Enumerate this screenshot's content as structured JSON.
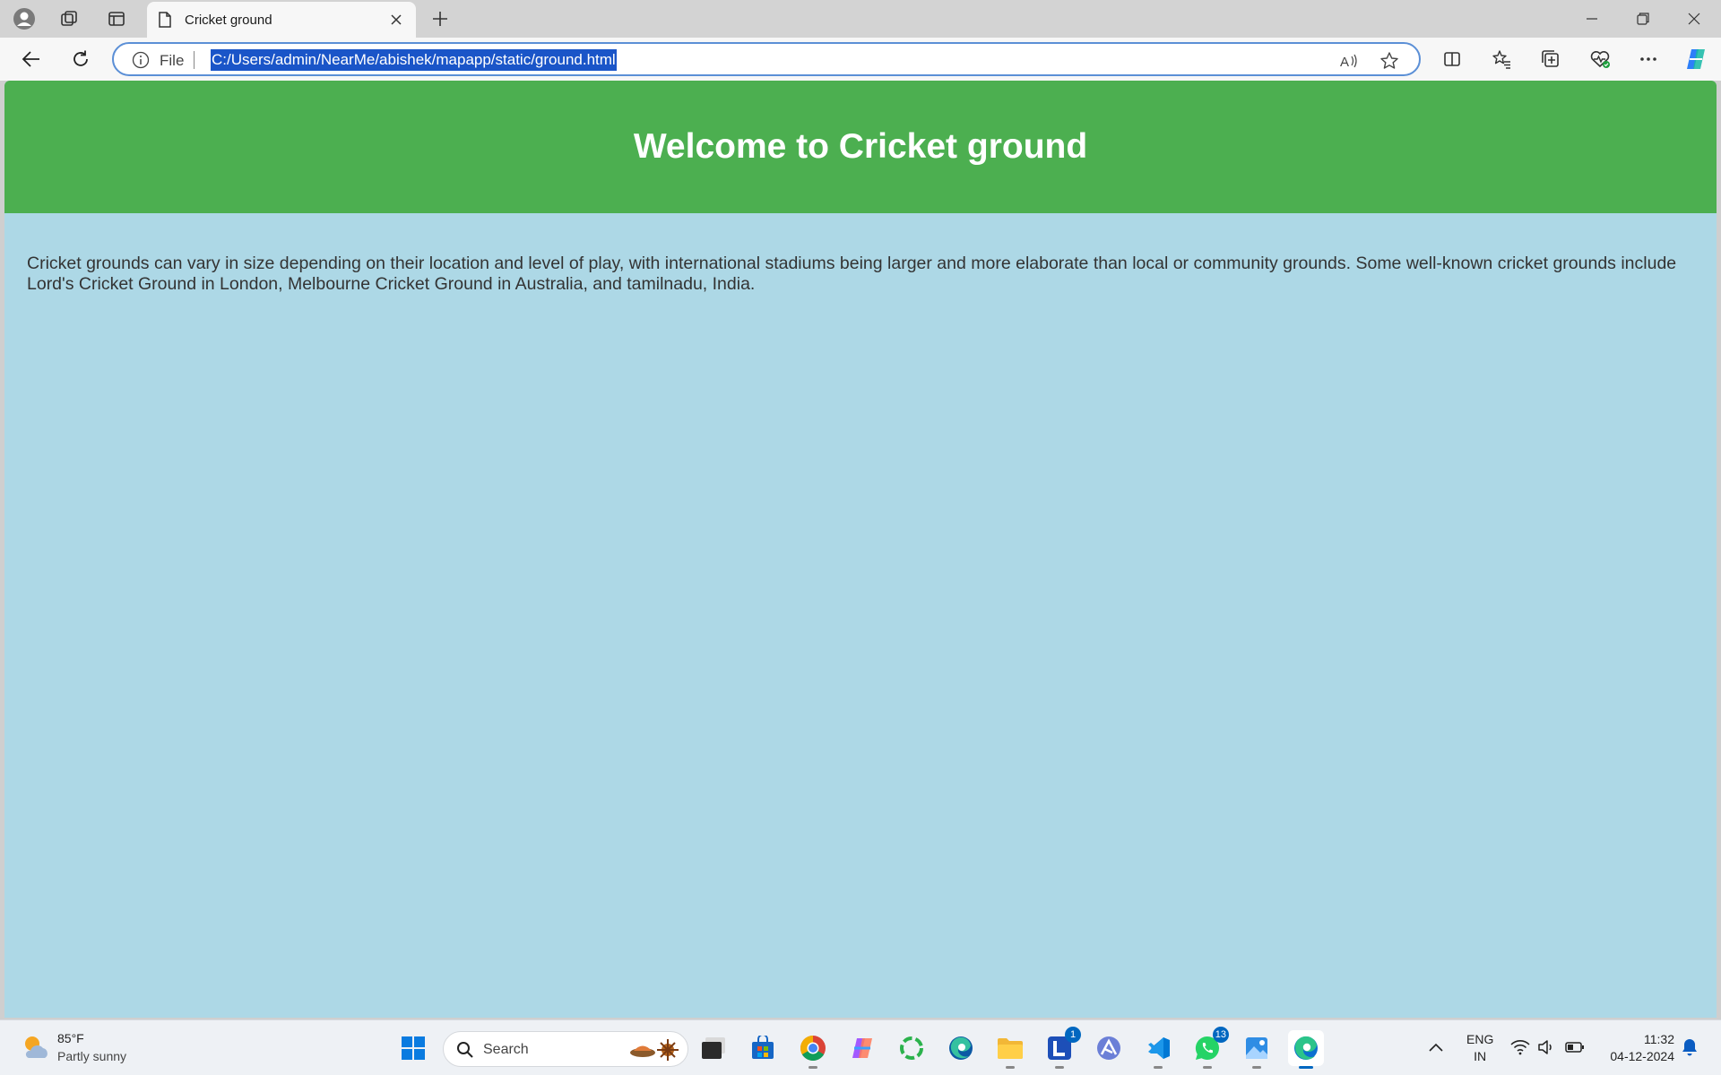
{
  "browser": {
    "tab_title": "Cricket ground",
    "address_prefix": "File",
    "url": "C:/Users/admin/NearMe/abishek/mapapp/static/ground.html"
  },
  "page": {
    "title": "Welcome to Cricket ground",
    "paragraph": "Cricket grounds can vary in size depending on their location and level of play, with international stadiums being larger and more elaborate than local or community grounds. Some well-known cricket grounds include Lord's Cricket Ground in London, Melbourne Cricket Ground in Australia, and tamilnadu, India.",
    "header_color": "#4caf50",
    "background_color": "#add8e6"
  },
  "taskbar": {
    "weather_temp": "85°F",
    "weather_desc": "Partly sunny",
    "search_placeholder": "Search",
    "lang_line1": "ENG",
    "lang_line2": "IN",
    "time": "11:32",
    "date": "04-12-2024",
    "badges": {
      "l_app": "1",
      "whatsapp": "13"
    }
  },
  "icons": [
    "profile-icon",
    "workspaces-icon",
    "tab-actions-icon",
    "page-icon",
    "close-icon",
    "plus-icon",
    "minimize-icon",
    "restore-icon",
    "back-icon",
    "refresh-icon",
    "info-icon",
    "read-aloud-icon",
    "favorite-star-icon",
    "split-screen-icon",
    "favorites-icon",
    "collections-icon",
    "browser-essentials-icon",
    "more-icon",
    "copilot-icon",
    "windows-start-icon",
    "search-icon",
    "wifi-icon",
    "volume-icon",
    "battery-icon",
    "notification-bell-icon",
    "chevron-up-icon"
  ]
}
